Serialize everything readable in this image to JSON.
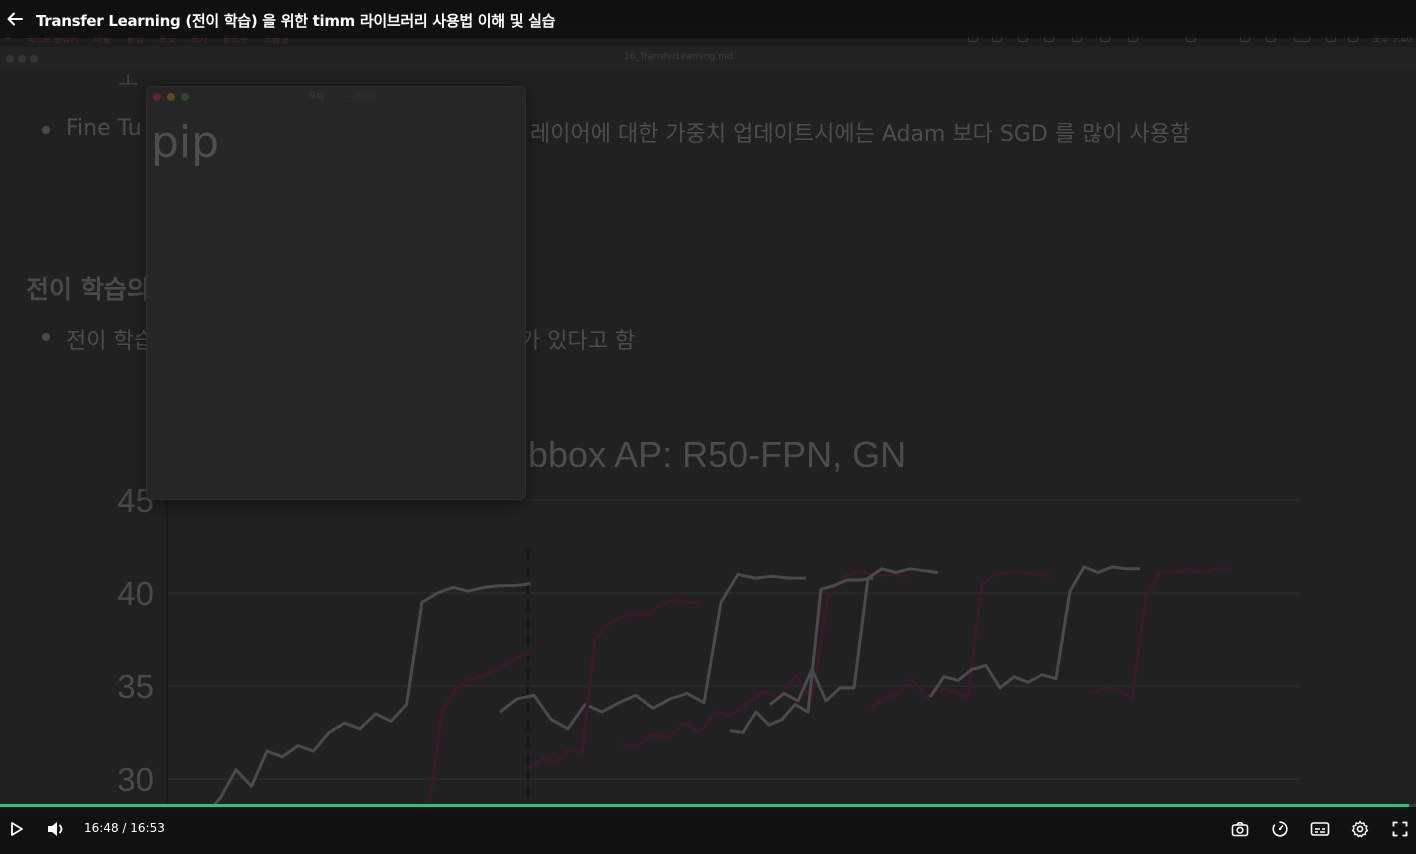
{
  "player": {
    "title": "Transfer Learning (전이 학습) 을 위한 timm 라이브러리 사용법 이해 및 실습",
    "current_time": "16:48",
    "separator": " / ",
    "duration": "16:53",
    "progress_fraction": 0.995,
    "accent_color": "#20c873"
  },
  "mac_menubar": {
    "menus": [
      "텍스트 편집기",
      "파일",
      "편집",
      "포맷",
      "보기",
      "윈도우",
      "도움말"
    ],
    "clock": "오후 5:40"
  },
  "editor": {
    "filename": "16_TransferLearning.md"
  },
  "slide": {
    "bullet1": "Fine Tu",
    "bullet1_tail": "레이어에 대한 가중치 업데이트시에는 Adam 보다 SGD 를 많이 사용함",
    "heading": "전이 학습의",
    "bullet2": "전이 학습",
    "bullet2_tail": "가 있다고 함"
  },
  "pip": {
    "title": "무제",
    "subtitle": "— 편집됨",
    "text": "pip"
  },
  "chart_data": {
    "type": "line",
    "title": "bbox AP: R50-FPN, GN",
    "yticks": [
      "45",
      "40",
      "35",
      "30"
    ],
    "ylim": [
      28,
      46
    ],
    "grid": true,
    "series": [
      {
        "values": [
          28,
          29,
          30.5,
          29.6,
          31.5,
          31.2,
          31.8,
          31.5,
          32.5,
          33,
          32.7,
          33.5,
          33.1,
          34,
          39.5,
          40,
          40.3,
          40.1,
          40.3,
          40.4,
          40.4,
          40.5
        ]
      },
      {
        "values": [
          28,
          28.1,
          28.1,
          28.6,
          33.6,
          34.8,
          35.3,
          35.5,
          35.8,
          36.2,
          36.6,
          36.8
        ]
      },
      {
        "values": [
          33.6,
          34.3,
          34.5,
          33.2,
          32.7,
          34,
          33.6,
          34.1,
          34.5,
          33.8,
          34.3,
          34.6,
          34.1,
          39.5,
          41,
          40.8,
          40.9,
          40.8,
          40.8
        ]
      },
      {
        "values": [
          30.6,
          31.1,
          30.9,
          31.6,
          31.4,
          37.5,
          38.3,
          38.7,
          38.9,
          38.8,
          39.4,
          39.6,
          39.5,
          39.5
        ]
      },
      {
        "values": [
          31.9,
          31.7,
          32.4,
          32.2,
          33,
          32.5,
          33.6,
          33.4,
          34.1,
          34.7,
          34.3,
          35.6,
          34.2,
          39.8,
          40.9,
          41.2,
          40.9,
          41,
          40.9
        ]
      },
      {
        "values": [
          32.6,
          32.5,
          33.6,
          32.9,
          33.2,
          34,
          33.6,
          40.2,
          40.4,
          40.7,
          40.7,
          40.8
        ]
      },
      {
        "values": [
          34,
          34.6,
          34.2,
          35.9,
          34.2,
          34.9,
          34.9,
          40.8,
          41.3,
          41.1,
          41.3,
          41.2,
          41.1
        ]
      },
      {
        "values": [
          33.8,
          34.3,
          34.6,
          35.4,
          34.4,
          34.9,
          34.7,
          34.4,
          40.5,
          41,
          41.1,
          41.1,
          41,
          40.9
        ]
      },
      {
        "values": [
          34.4,
          35.5,
          35.3,
          35.9,
          36.1,
          34.9,
          35.5,
          35.2,
          35.6,
          35.4,
          40.1,
          41.4,
          41.1,
          41.4,
          41.3,
          41.3
        ]
      },
      {
        "values": [
          34.6,
          34.9,
          34.8,
          34.3,
          39.8,
          41.1,
          41.1,
          41.3,
          41.1,
          41.3,
          41.3
        ]
      }
    ]
  }
}
